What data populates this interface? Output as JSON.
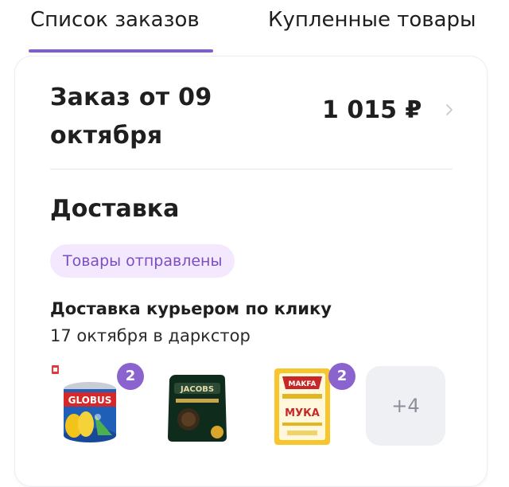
{
  "tabs": [
    {
      "label": "Список заказов",
      "active": true
    },
    {
      "label": "Купленные товары",
      "active": false
    }
  ],
  "order": {
    "title": "Заказ от 09\nоктября",
    "total": "1 015 ₽"
  },
  "delivery": {
    "section_title": "Доставка",
    "status": "Товары отправлены",
    "method": "Доставка курьером по клику",
    "date": "17 октября в даркстор"
  },
  "products": [
    {
      "icon": "canned-corn-image",
      "brand": "GLOBUS",
      "qty": "2"
    },
    {
      "icon": "coffee-pack-image",
      "brand": "JACOBS",
      "qty": ""
    },
    {
      "icon": "flour-pack-image",
      "brand": "MAKFA",
      "subtitle": "МУКА",
      "qty": "2"
    }
  ],
  "more_count": "+4",
  "colors": {
    "accent": "#7f5ec6",
    "badge_bg": "#f4e8ff",
    "badge_text": "#7a4fbf",
    "qty_badge": "#8a63cf"
  }
}
